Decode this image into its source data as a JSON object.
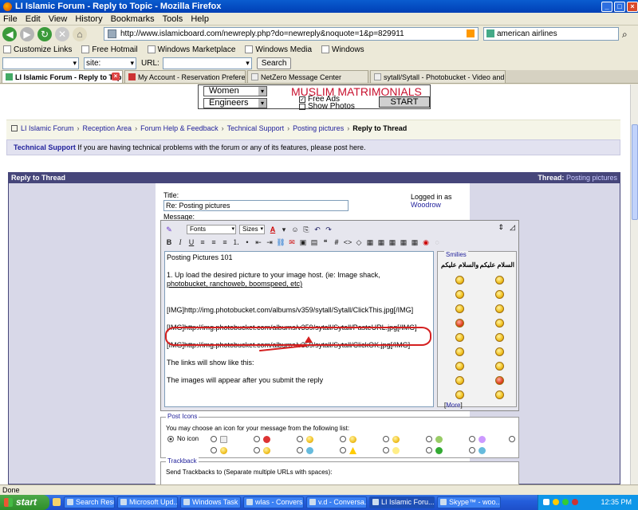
{
  "window": {
    "title": "LI Islamic Forum - Reply to Topic - Mozilla Firefox",
    "controls": [
      "_",
      "□",
      "×"
    ]
  },
  "menu": [
    "File",
    "Edit",
    "View",
    "History",
    "Bookmarks",
    "Tools",
    "Help"
  ],
  "nav": {
    "url": "http://www.islamicboard.com/newreply.php?do=newreply&noquote=1&p=829911",
    "search_value": "american airlines"
  },
  "bookmarks": [
    "Customize Links",
    "Free Hotmail",
    "Windows Marketplace",
    "Windows Media",
    "Windows"
  ],
  "toolbar2": {
    "site_label": "site:",
    "url_label": "URL:",
    "search_button": "Search"
  },
  "tabs": [
    {
      "label": "LI Islamic Forum - Reply to Topic",
      "active": true
    },
    {
      "label": "My Account - Reservation Preferences",
      "active": false
    },
    {
      "label": "NetZero Message Center",
      "active": false
    },
    {
      "label": "sytall/Sytall - Photobucket - Video and...",
      "active": false
    }
  ],
  "banner": {
    "title": "MUSLIM MATRIMONIALS",
    "select1": "Women",
    "select2": "Engineers",
    "check1": "Free Ads",
    "check2": "Show Photos",
    "start": "START"
  },
  "breadcrumb": [
    "LI Islamic Forum",
    "Reception Area",
    "Forum Help & Feedback",
    "Technical Support",
    "Posting pictures",
    "Reply to Thread"
  ],
  "section": {
    "name": "Technical Support",
    "desc": "If you are having technical problems with the forum or any of its features, please post here."
  },
  "reply": {
    "header": "Reply to Thread",
    "thread_label": "Thread:",
    "thread_name": "Posting pictures",
    "title_label": "Title:",
    "title_value": "Re: Posting pictures",
    "logged_in_label": "Logged in as",
    "user": "Woodrow",
    "message_label": "Message:"
  },
  "editor": {
    "font_select": "Fonts",
    "size_select": "Sizes",
    "lines": [
      "Posting Pictures 101",
      "",
      "1. Up load the desired picture to your image host. (ie: Image shack,",
      "photobucket, ranchoweb, boomspeed, etc)",
      "",
      "",
      "[IMG]http://img.photobucket.com/albums/v359/sytall/Sytall/ClickThis.jpg[/IMG]",
      "",
      "[IMG]http://img.photobucket.com/albums/v359/sytall/Sytall/PasteURL.jpg[/IMG]",
      "",
      "[IMG]http://img.photobucket.com/albums/v359/sytall/Sytall/ClickOK.jpg[/IMG]",
      "",
      "The links will show like this:",
      "",
      "The images will appear after you submit the reply"
    ]
  },
  "smilies": {
    "label": "Smilies",
    "col1_head": "السلام عليكم",
    "col2_head": "والسلام عليكم",
    "more": "More"
  },
  "post_icons": {
    "legend": "Post Icons",
    "text": "You may choose an icon for your message from the following list:",
    "no_icon": "No icon"
  },
  "trackback": {
    "legend": "Trackback",
    "text": "Send Trackbacks to (Separate multiple URLs with spaces):"
  },
  "status": "Done",
  "taskbar": {
    "start": "start",
    "tasks": [
      "Search Results",
      "Microsoft Upd...",
      "Windows Task ...",
      "wlas - Convers...",
      "v.d - Conversa...",
      "LI Islamic Foru...",
      "Skype™ - woo..."
    ],
    "clock": "12:35 PM"
  }
}
